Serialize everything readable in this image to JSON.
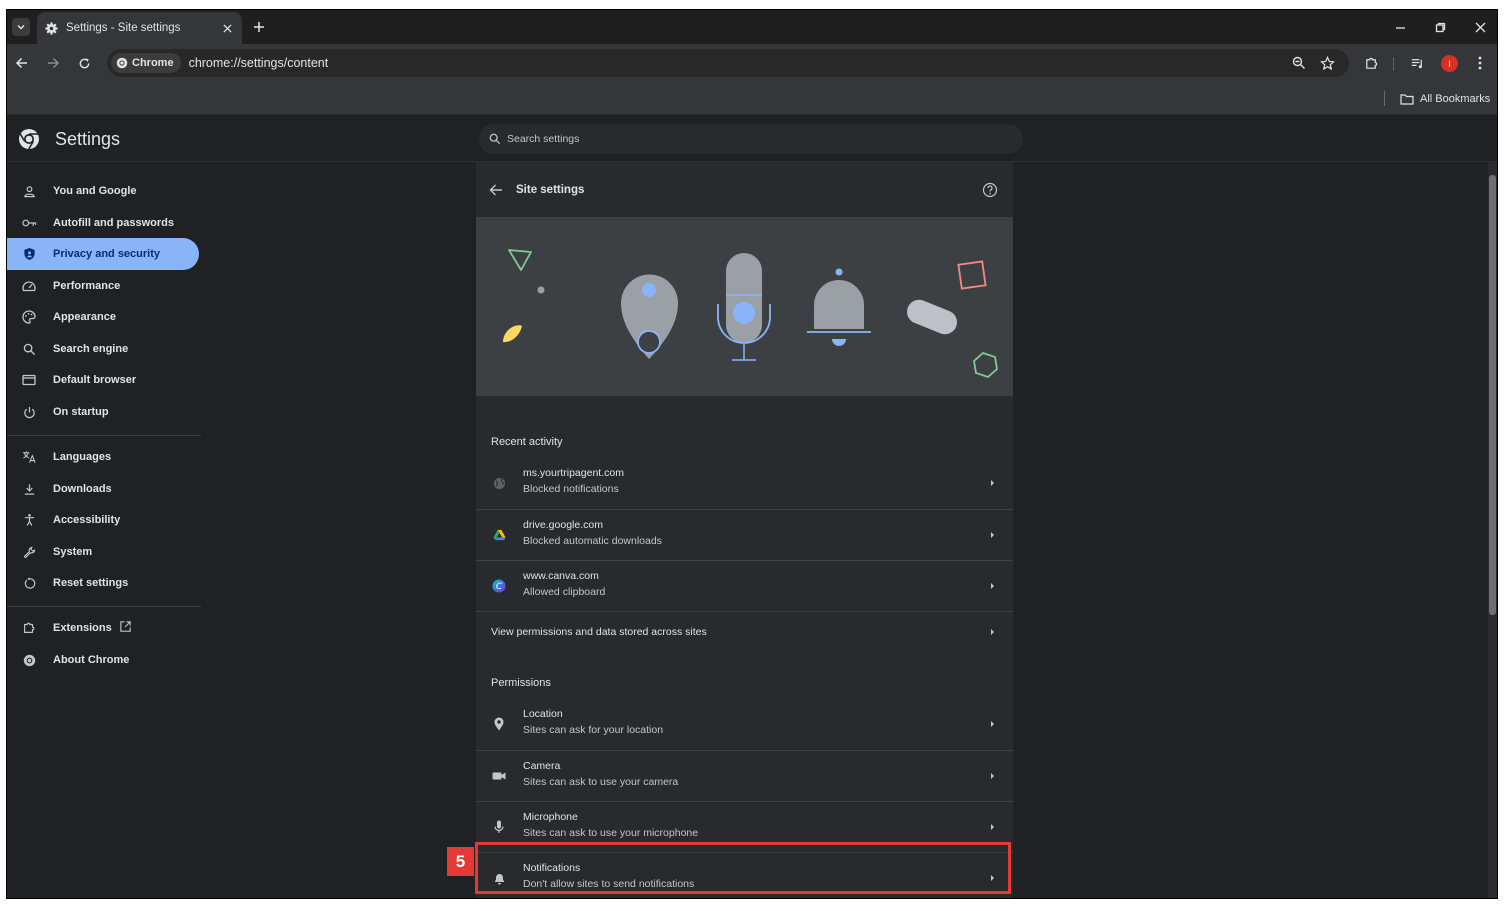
{
  "tab": {
    "title": "Settings - Site settings"
  },
  "toolbar": {
    "chip_label": "Chrome",
    "url": "chrome://settings/content",
    "avatar_letter": "I"
  },
  "bookmarks": {
    "all_label": "All Bookmarks"
  },
  "header": {
    "title": "Settings",
    "search_placeholder": "Search settings"
  },
  "sidebar": {
    "items": [
      {
        "label": "You and Google",
        "icon": "person-icon"
      },
      {
        "label": "Autofill and passwords",
        "icon": "key-icon"
      },
      {
        "label": "Privacy and security",
        "icon": "shield-icon",
        "active": true
      },
      {
        "label": "Performance",
        "icon": "speedometer-icon"
      },
      {
        "label": "Appearance",
        "icon": "palette-icon"
      },
      {
        "label": "Search engine",
        "icon": "search-icon"
      },
      {
        "label": "Default browser",
        "icon": "browser-icon"
      },
      {
        "label": "On startup",
        "icon": "power-icon"
      },
      {
        "label": "Languages",
        "icon": "translate-icon"
      },
      {
        "label": "Downloads",
        "icon": "download-icon"
      },
      {
        "label": "Accessibility",
        "icon": "accessibility-icon"
      },
      {
        "label": "System",
        "icon": "wrench-icon"
      },
      {
        "label": "Reset settings",
        "icon": "reset-icon"
      },
      {
        "label": "Extensions",
        "icon": "puzzle-icon"
      },
      {
        "label": "About Chrome",
        "icon": "chrome-icon"
      }
    ]
  },
  "main": {
    "title": "Site settings",
    "recent_label": "Recent activity",
    "recent": [
      {
        "site": "ms.yourtripagent.com",
        "detail": "Blocked notifications",
        "icon": "globe-icon"
      },
      {
        "site": "drive.google.com",
        "detail": "Blocked automatic downloads",
        "icon": "google-drive-icon"
      },
      {
        "site": "www.canva.com",
        "detail": "Allowed clipboard",
        "icon": "canva-icon"
      }
    ],
    "view_all": "View permissions and data stored across sites",
    "permissions_label": "Permissions",
    "permissions": [
      {
        "name": "Location",
        "detail": "Sites can ask for your location",
        "icon": "location-pin-icon"
      },
      {
        "name": "Camera",
        "detail": "Sites can ask to use your camera",
        "icon": "camera-icon"
      },
      {
        "name": "Microphone",
        "detail": "Sites can ask to use your microphone",
        "icon": "microphone-icon"
      },
      {
        "name": "Notifications",
        "detail": "Don't allow sites to send notifications",
        "icon": "bell-icon"
      }
    ]
  },
  "annotation": {
    "badge": "5",
    "color": "#e53935"
  },
  "colors": {
    "active_nav": "#8ab4f8",
    "background": "#202124",
    "card": "#292a2d"
  }
}
